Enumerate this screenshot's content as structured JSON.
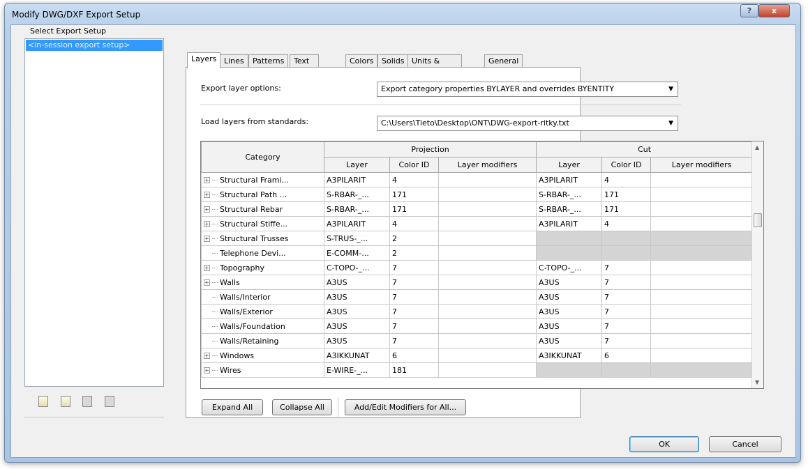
{
  "window": {
    "title": "Modify DWG/DXF Export Setup",
    "help": "?",
    "close": "x"
  },
  "left": {
    "label": "Select Export Setup",
    "items": [
      "<in-session export setup>"
    ],
    "icons": [
      "new-setup-icon",
      "duplicate-setup-icon",
      "rename-setup-icon",
      "delete-setup-icon"
    ]
  },
  "tabs": [
    "Layers",
    "Lines",
    "Patterns",
    "Text & Fonts",
    "Colors",
    "Solids",
    "Units & Coordinates",
    "General"
  ],
  "active_tab": "Layers",
  "options": {
    "export_label": "Export layer options:",
    "export_value": "Export category properties BYLAYER and overrides BYENTITY",
    "load_label": "Load layers from standards:",
    "load_value": "C:\\Users\\Tieto\\Desktop\\ONT\\DWG-export-ritky.txt"
  },
  "table": {
    "category_header": "Category",
    "projection_header": "Projection",
    "cut_header": "Cut",
    "sub_headers": [
      "Layer",
      "Color ID",
      "Layer modifiers",
      "Layer",
      "Color ID",
      "Layer modifiers"
    ],
    "rows": [
      {
        "cat": "Structural Frami...",
        "exp": true,
        "p_layer": "A3PILARIT",
        "p_color": "4",
        "c_layer": "A3PILARIT",
        "c_color": "4",
        "cut_na": false
      },
      {
        "cat": "Structural Path ...",
        "exp": true,
        "p_layer": "S-RBAR-_...",
        "p_color": "171",
        "c_layer": "S-RBAR-_...",
        "c_color": "171",
        "cut_na": false
      },
      {
        "cat": "Structural Rebar",
        "exp": true,
        "p_layer": "S-RBAR-_...",
        "p_color": "171",
        "c_layer": "S-RBAR-_...",
        "c_color": "171",
        "cut_na": false
      },
      {
        "cat": "Structural Stiffe...",
        "exp": true,
        "p_layer": "A3PILARIT",
        "p_color": "4",
        "c_layer": "A3PILARIT",
        "c_color": "4",
        "cut_na": false
      },
      {
        "cat": "Structural Trusses",
        "exp": true,
        "p_layer": "S-TRUS-_...",
        "p_color": "2",
        "c_layer": "",
        "c_color": "",
        "cut_na": true
      },
      {
        "cat": "Telephone Devi...",
        "exp": false,
        "p_layer": "E-COMM-...",
        "p_color": "2",
        "c_layer": "",
        "c_color": "",
        "cut_na": true
      },
      {
        "cat": "Topography",
        "exp": true,
        "p_layer": "C-TOPO-_...",
        "p_color": "7",
        "c_layer": "C-TOPO-_...",
        "c_color": "7",
        "cut_na": false
      },
      {
        "cat": "Walls",
        "exp": true,
        "p_layer": "A3US",
        "p_color": "7",
        "c_layer": "A3US",
        "c_color": "7",
        "cut_na": false
      },
      {
        "cat": "Walls/Interior",
        "exp": false,
        "p_layer": "A3US",
        "p_color": "7",
        "c_layer": "A3US",
        "c_color": "7",
        "cut_na": false
      },
      {
        "cat": "Walls/Exterior",
        "exp": false,
        "p_layer": "A3US",
        "p_color": "7",
        "c_layer": "A3US",
        "c_color": "7",
        "cut_na": false
      },
      {
        "cat": "Walls/Foundation",
        "exp": false,
        "p_layer": "A3US",
        "p_color": "7",
        "c_layer": "A3US",
        "c_color": "7",
        "cut_na": false
      },
      {
        "cat": "Walls/Retaining",
        "exp": false,
        "p_layer": "A3US",
        "p_color": "7",
        "c_layer": "A3US",
        "c_color": "7",
        "cut_na": false
      },
      {
        "cat": "Windows",
        "exp": true,
        "p_layer": "A3IKKUNAT",
        "p_color": "6",
        "c_layer": "A3IKKUNAT",
        "c_color": "6",
        "cut_na": false
      },
      {
        "cat": "Wires",
        "exp": true,
        "p_layer": "E-WIRE-_...",
        "p_color": "181",
        "c_layer": "",
        "c_color": "",
        "cut_na": true
      }
    ]
  },
  "buttons": {
    "expand_all": "Expand All",
    "collapse_all": "Collapse All",
    "add_edit": "Add/Edit Modifiers for All...",
    "ok": "OK",
    "cancel": "Cancel"
  },
  "colors": {
    "selection": "#3399ff",
    "na_cell": "#d4d4d4",
    "titlebar": "#b7cfe9"
  }
}
